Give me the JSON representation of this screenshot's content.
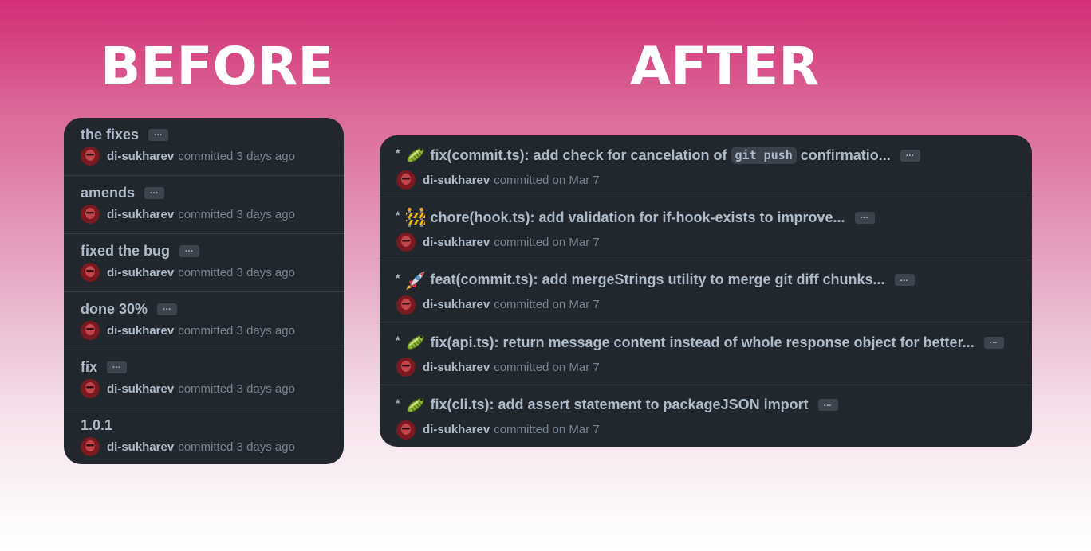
{
  "headings": {
    "before": "BEFORE",
    "after": "AFTER"
  },
  "colors": {
    "panel_bg": "#22272e",
    "divider": "#373e47",
    "text_primary": "#adbac7",
    "text_muted": "#768390",
    "gradient_top": "#d32e74",
    "gradient_bottom": "#ffffff"
  },
  "before": {
    "commits": [
      {
        "message": "the fixes",
        "ellipsis": "…",
        "author": "di-sukharev",
        "when": "committed 3 days ago"
      },
      {
        "message": "amends",
        "ellipsis": "…",
        "author": "di-sukharev",
        "when": "committed 3 days ago"
      },
      {
        "message": "fixed the bug",
        "ellipsis": "…",
        "author": "di-sukharev",
        "when": "committed 3 days ago"
      },
      {
        "message": "done 30%",
        "ellipsis": "…",
        "author": "di-sukharev",
        "when": "committed 3 days ago"
      },
      {
        "message": "fix",
        "ellipsis": "…",
        "author": "di-sukharev",
        "when": "committed 3 days ago"
      },
      {
        "message": "1.0.1",
        "author": "di-sukharev",
        "when": "committed 3 days ago"
      }
    ]
  },
  "after": {
    "commits": [
      {
        "bullet": "*",
        "emoji": "bug-emoji-icon",
        "message": "fix(commit.ts): add check for cancelation of",
        "code": "git push",
        "message_tail": "confirmatio...",
        "ellipsis": "…",
        "author": "di-sukharev",
        "when": "committed on Mar 7"
      },
      {
        "bullet": "*",
        "emoji": "construction-emoji-icon",
        "message": "chore(hook.ts): add validation for if-hook-exists to improve...",
        "ellipsis": "…",
        "author": "di-sukharev",
        "when": "committed on Mar 7"
      },
      {
        "bullet": "*",
        "emoji": "rocket-emoji-icon",
        "message": "feat(commit.ts): add mergeStrings utility to merge git diff chunks...",
        "ellipsis": "…",
        "author": "di-sukharev",
        "when": "committed on Mar 7"
      },
      {
        "bullet": "*",
        "emoji": "bug-emoji-icon",
        "message": "fix(api.ts): return message content instead of whole response object for better...",
        "ellipsis": "…",
        "author": "di-sukharev",
        "when": "committed on Mar 7"
      },
      {
        "bullet": "*",
        "emoji": "bug-emoji-icon",
        "message": "fix(cli.ts): add assert statement to packageJSON import",
        "ellipsis": "…",
        "author": "di-sukharev",
        "when": "committed on Mar 7"
      }
    ]
  }
}
